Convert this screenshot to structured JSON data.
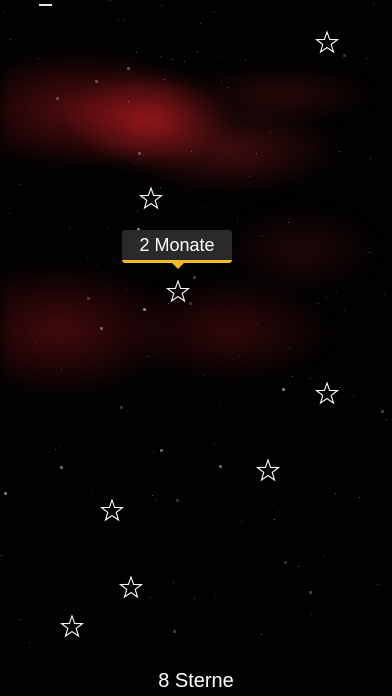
{
  "tooltip": {
    "text": "2 Monate"
  },
  "footer": {
    "count_label": "8 Sterne"
  },
  "colors": {
    "background": "#020202",
    "nebula": "#b11e23",
    "tooltip_bg": "#2a2a2a",
    "tooltip_accent": "#f2b928",
    "star_outline": "#ffffff"
  },
  "icons": {
    "star": "star-outline-icon"
  }
}
